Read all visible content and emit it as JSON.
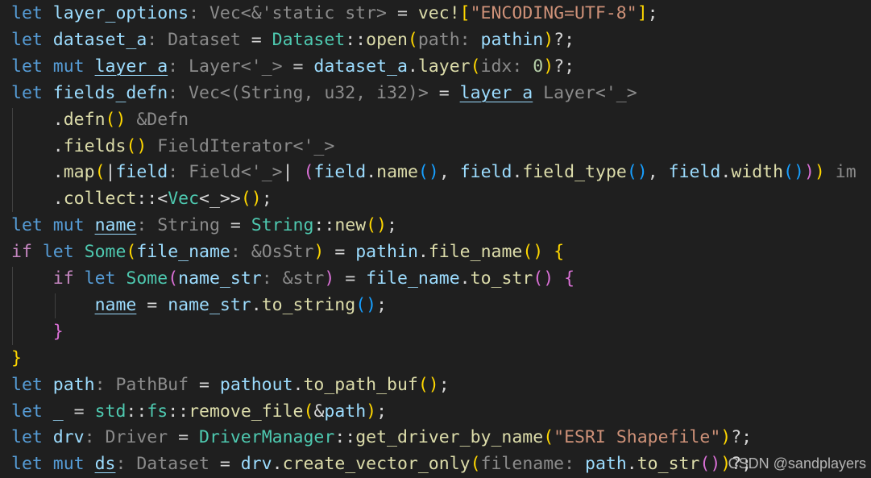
{
  "editor": {
    "language": "Rust",
    "theme": {
      "background": "#1f1f1f",
      "keyword": "#569cd6",
      "control": "#c586c0",
      "variable": "#9cdcfe",
      "function": "#dcdcaa",
      "type": "#4ec9b0",
      "string": "#ce9178",
      "number": "#b5cea8",
      "inlay_hint": "#8b8b8b",
      "bracket_1": "#ffd700",
      "bracket_2": "#da70d6",
      "bracket_3": "#179fff"
    },
    "lines": [
      [
        [
          "kw",
          "let "
        ],
        [
          "var",
          "layer_options"
        ],
        [
          "hint",
          ": Vec<&'static str>"
        ],
        [
          "pl",
          " = "
        ],
        [
          "fn",
          "vec!"
        ],
        [
          "p0",
          "["
        ],
        [
          "str",
          "\"ENCODING=UTF-8\""
        ],
        [
          "p0",
          "]"
        ],
        [
          "pl",
          ";"
        ]
      ],
      [
        [
          "kw",
          "let "
        ],
        [
          "var",
          "dataset_a"
        ],
        [
          "hint",
          ": Dataset"
        ],
        [
          "pl",
          " = "
        ],
        [
          "ty",
          "Dataset"
        ],
        [
          "pl",
          "::"
        ],
        [
          "fn",
          "open"
        ],
        [
          "p0",
          "("
        ],
        [
          "hint",
          "path: "
        ],
        [
          "var",
          "pathin"
        ],
        [
          "p0",
          ")"
        ],
        [
          "pl",
          "?;"
        ]
      ],
      [
        [
          "kw",
          "let "
        ],
        [
          "kw",
          "mut "
        ],
        [
          "var mut",
          "layer_a"
        ],
        [
          "hint",
          ": Layer<'_>"
        ],
        [
          "pl",
          " = "
        ],
        [
          "var",
          "dataset_a"
        ],
        [
          "pl",
          "."
        ],
        [
          "fn",
          "layer"
        ],
        [
          "p0",
          "("
        ],
        [
          "hint",
          "idx: "
        ],
        [
          "num",
          "0"
        ],
        [
          "p0",
          ")"
        ],
        [
          "pl",
          "?;"
        ]
      ],
      [
        [
          "kw",
          "let "
        ],
        [
          "var",
          "fields_defn"
        ],
        [
          "hint",
          ": Vec<(String, u32, i32)>"
        ],
        [
          "pl",
          " = "
        ],
        [
          "var mut",
          "layer_a"
        ],
        [
          "hint",
          " Layer<'_>"
        ]
      ],
      [
        [
          "pl",
          "    ."
        ],
        [
          "fn",
          "defn"
        ],
        [
          "p0",
          "()"
        ],
        [
          "hint",
          " &Defn"
        ]
      ],
      [
        [
          "pl",
          "    ."
        ],
        [
          "fn",
          "fields"
        ],
        [
          "p0",
          "()"
        ],
        [
          "hint",
          " FieldIterator<'_>"
        ]
      ],
      [
        [
          "pl",
          "    ."
        ],
        [
          "fn",
          "map"
        ],
        [
          "p0",
          "("
        ],
        [
          "pl",
          "|"
        ],
        [
          "var",
          "field"
        ],
        [
          "hint",
          ": Field<'_>"
        ],
        [
          "pl",
          "| "
        ],
        [
          "p1",
          "("
        ],
        [
          "var",
          "field"
        ],
        [
          "pl",
          "."
        ],
        [
          "fn",
          "name"
        ],
        [
          "p2",
          "()"
        ],
        [
          "pl",
          ", "
        ],
        [
          "var",
          "field"
        ],
        [
          "pl",
          "."
        ],
        [
          "fn",
          "field_type"
        ],
        [
          "p2",
          "()"
        ],
        [
          "pl",
          ", "
        ],
        [
          "var",
          "field"
        ],
        [
          "pl",
          "."
        ],
        [
          "fn",
          "width"
        ],
        [
          "p2",
          "()"
        ],
        [
          "p1",
          ")"
        ],
        [
          "p0",
          ")"
        ],
        [
          "hint",
          " im"
        ]
      ],
      [
        [
          "pl",
          "    ."
        ],
        [
          "fn",
          "collect"
        ],
        [
          "pl",
          "::<"
        ],
        [
          "ty",
          "Vec"
        ],
        [
          "pl",
          "<_>>"
        ],
        [
          "p0",
          "()"
        ],
        [
          "pl",
          ";"
        ]
      ],
      [
        [
          "kw",
          "let "
        ],
        [
          "kw",
          "mut "
        ],
        [
          "var mut",
          "name"
        ],
        [
          "hint",
          ": String"
        ],
        [
          "pl",
          " = "
        ],
        [
          "ty",
          "String"
        ],
        [
          "pl",
          "::"
        ],
        [
          "fn",
          "new"
        ],
        [
          "p0",
          "()"
        ],
        [
          "pl",
          ";"
        ]
      ],
      [
        [
          "ctl",
          "if "
        ],
        [
          "kw",
          "let "
        ],
        [
          "ty",
          "Some"
        ],
        [
          "p0",
          "("
        ],
        [
          "var",
          "file_name"
        ],
        [
          "hint",
          ": &OsStr"
        ],
        [
          "p0",
          ")"
        ],
        [
          "pl",
          " = "
        ],
        [
          "var",
          "pathin"
        ],
        [
          "pl",
          "."
        ],
        [
          "fn",
          "file_name"
        ],
        [
          "p0",
          "()"
        ],
        [
          "pl",
          " "
        ],
        [
          "p0",
          "{"
        ]
      ],
      [
        [
          "pl",
          "    "
        ],
        [
          "ctl",
          "if "
        ],
        [
          "kw",
          "let "
        ],
        [
          "ty",
          "Some"
        ],
        [
          "p1",
          "("
        ],
        [
          "var",
          "name_str"
        ],
        [
          "hint",
          ": &str"
        ],
        [
          "p1",
          ")"
        ],
        [
          "pl",
          " = "
        ],
        [
          "var",
          "file_name"
        ],
        [
          "pl",
          "."
        ],
        [
          "fn",
          "to_str"
        ],
        [
          "p1",
          "()"
        ],
        [
          "pl",
          " "
        ],
        [
          "p1",
          "{"
        ]
      ],
      [
        [
          "pl",
          "        "
        ],
        [
          "var mut",
          "name"
        ],
        [
          "pl",
          " = "
        ],
        [
          "var",
          "name_str"
        ],
        [
          "pl",
          "."
        ],
        [
          "fn",
          "to_string"
        ],
        [
          "p2",
          "()"
        ],
        [
          "pl",
          ";"
        ]
      ],
      [
        [
          "pl",
          "    "
        ],
        [
          "p1",
          "}"
        ]
      ],
      [
        [
          "p0",
          "}"
        ]
      ],
      [
        [
          "kw",
          "let "
        ],
        [
          "var",
          "path"
        ],
        [
          "hint",
          ": PathBuf"
        ],
        [
          "pl",
          " = "
        ],
        [
          "var",
          "pathout"
        ],
        [
          "pl",
          "."
        ],
        [
          "fn",
          "to_path_buf"
        ],
        [
          "p0",
          "()"
        ],
        [
          "pl",
          ";"
        ]
      ],
      [
        [
          "kw",
          "let "
        ],
        [
          "var",
          "_"
        ],
        [
          "pl",
          " = "
        ],
        [
          "ty",
          "std"
        ],
        [
          "pl",
          "::"
        ],
        [
          "ty",
          "fs"
        ],
        [
          "pl",
          "::"
        ],
        [
          "fn",
          "remove_file"
        ],
        [
          "p0",
          "("
        ],
        [
          "pl",
          "&"
        ],
        [
          "var",
          "path"
        ],
        [
          "p0",
          ")"
        ],
        [
          "pl",
          ";"
        ]
      ],
      [
        [
          "kw",
          "let "
        ],
        [
          "var",
          "drv"
        ],
        [
          "hint",
          ": Driver"
        ],
        [
          "pl",
          " = "
        ],
        [
          "ty",
          "DriverManager"
        ],
        [
          "pl",
          "::"
        ],
        [
          "fn",
          "get_driver_by_name"
        ],
        [
          "p0",
          "("
        ],
        [
          "str",
          "\"ESRI Shapefile\""
        ],
        [
          "p0",
          ")"
        ],
        [
          "pl",
          "?;"
        ]
      ],
      [
        [
          "kw",
          "let "
        ],
        [
          "kw",
          "mut "
        ],
        [
          "var mut",
          "ds"
        ],
        [
          "hint",
          ": Dataset"
        ],
        [
          "pl",
          " = "
        ],
        [
          "var",
          "drv"
        ],
        [
          "pl",
          "."
        ],
        [
          "fn",
          "create_vector_only"
        ],
        [
          "p0",
          "("
        ],
        [
          "hint",
          "filename: "
        ],
        [
          "var",
          "path"
        ],
        [
          "pl",
          "."
        ],
        [
          "fn",
          "to_str"
        ],
        [
          "p1",
          "()"
        ],
        [
          "p0",
          ")"
        ],
        [
          "pl",
          "?;"
        ]
      ]
    ],
    "watermark": "CSDN @sandplayers"
  }
}
